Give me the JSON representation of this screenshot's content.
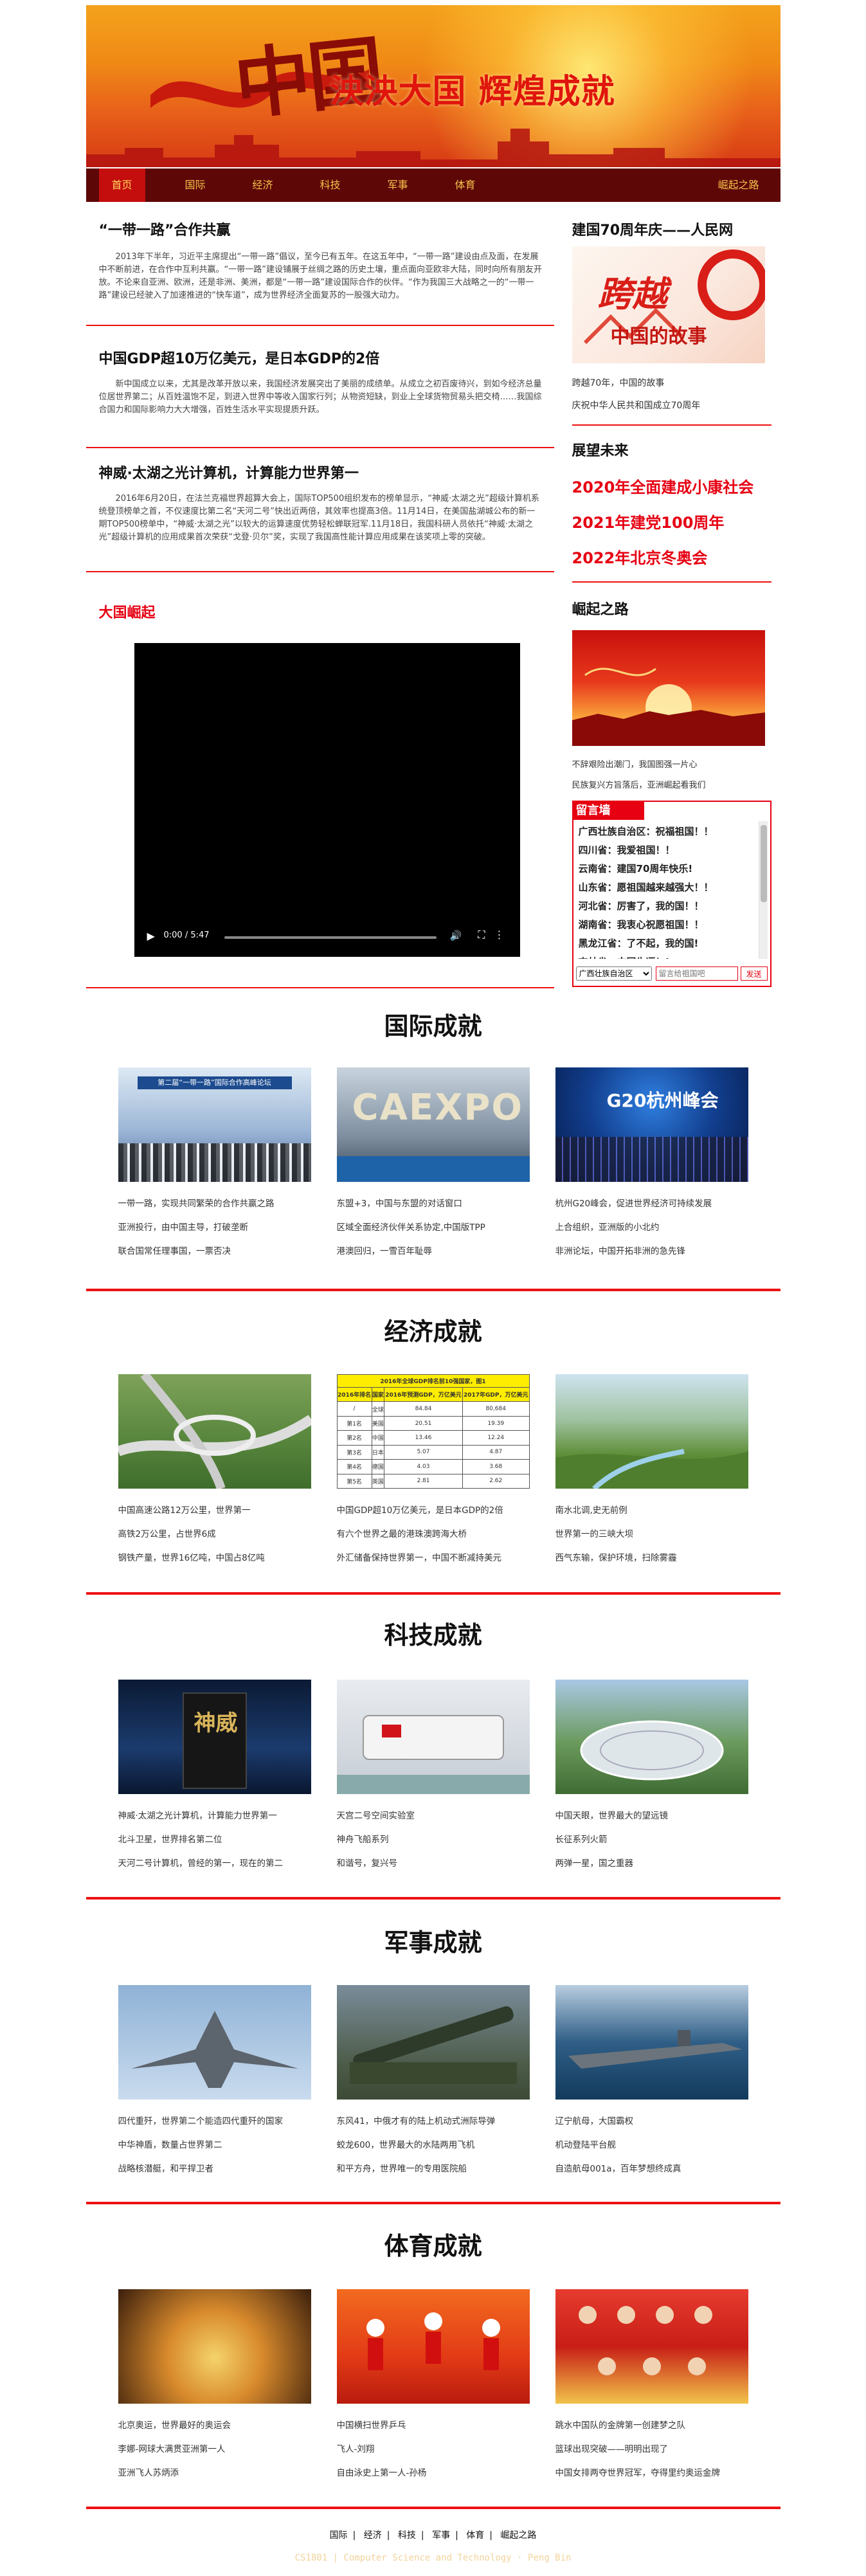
{
  "banner": {
    "calligraphy": "中国",
    "slogan": "泱泱大国 辉煌成就"
  },
  "nav": {
    "items": [
      "首页",
      "国际",
      "经济",
      "科技",
      "军事",
      "体育"
    ],
    "right": "崛起之路"
  },
  "articles": [
    {
      "title": "“一带一路”合作共赢",
      "body": "2013年下半年，习近平主席提出“一带一路”倡议，至今已有五年。在这五年中，“一带一路”建设由点及面，在发展中不断前进，在合作中互利共赢。“一带一路”建设铺展于丝绸之路的历史土壤，重点面向亚欧非大陆，同时向所有朋友开放。不论来自亚洲、欧洲，还是非洲、美洲，都是“一带一路”建设国际合作的伙伴。“作为我国三大战略之一的“一带一路”建设已经驶入了加速推进的“快车道”，成为世界经济全面复苏的一股强大动力。"
    },
    {
      "title": "中国GDP超10万亿美元，是日本GDP的2倍",
      "body": "新中国成立以来，尤其是改革开放以来，我国经济发展突出了美丽的成绩单。从成立之初百废待兴，到如今经济总量位居世界第二；从百姓温饱不足，到进入世界中等收入国家行列；从物资短缺，到业上全球货物贸易头把交椅……我国综合国力和国际影响力大大增强，百姓生活水平实现提质升跃。"
    },
    {
      "title": "神威·太湖之光计算机，计算能力世界第一",
      "body": "2016年6月20日，在法兰克福世界超算大会上，国际TOP500组织发布的榜单显示，“神威·太湖之光”超级计算机系统登顶榜单之首，不仅速度比第二名“天河二号”快出近两倍，其效率也提高3倍。11月14日，在美国盐湖城公布的新一期TOP500榜单中，“神威·太湖之光”以较大的运算速度优势轻松蝉联冠军.11月18日，我国科研人员依托“神威·太湖之光”超级计算机的应用成果首次荣获“戈登·贝尔”奖，实现了我国高性能计算应用成果在该奖项上零的突破。"
    }
  ],
  "rise": {
    "title": "大国崛起",
    "video_time": "0:00 / 5:47"
  },
  "sidebar": {
    "block1_title": "建国70周年庆——人民网",
    "block1_img_text": "跨越",
    "block1_img_sub": "中国的故事",
    "block1_captions": [
      "跨越70年，中国的故事",
      "庆祝中华人民共和国成立70周年"
    ],
    "block2_title": "展望未来",
    "future": [
      "2020年全面建成小康社会",
      "2021年建党100周年",
      "2022年北京冬奥会"
    ],
    "block3_title": "崛起之路",
    "block3_caption": [
      "不辞艰险出潮门，我国图强一片心",
      "民族复兴方旨落后，亚洲崛起看我们"
    ],
    "message_board": {
      "title": "留言墙",
      "messages": [
        "广西壮族自治区：祝福祖国！！",
        "四川省：我爱祖国！！",
        "云南省：建国70周年快乐!",
        "山东省：愿祖国越来越强大！！",
        "河北省：厉害了，我的国！！",
        "湖南省：我衷心祝愿祖国！！",
        "黑龙江省：了不起，我的国!",
        "吉林省：中国牛逼！!"
      ],
      "province_select": "广西壮族自治区",
      "input_placeholder": "留言给祖国吧",
      "send": "发送"
    }
  },
  "categories": [
    {
      "title": "国际成就",
      "captions": [
        [
          "一带一路，实现共同繁荣的合作共赢之路",
          "亚洲投行，由中国主导，打破垄断",
          "联合国常任理事国，一票否决"
        ],
        [
          "东盟+3，中国与东盟的对话窗口",
          "区域全面经济伙伴关系协定,中国版TPP",
          "港澳回归，一雪百年耻辱"
        ],
        [
          "杭州G20峰会，促进世界经济可持续发展",
          "上合组织，亚洲版的小北约",
          "非洲论坛，中国开拓非洲的急先锋"
        ]
      ],
      "img_labels": [
        "第二届“一带一路”国际合作高峰论坛",
        "CAEXPO",
        "G20杭州峰会"
      ]
    },
    {
      "title": "经济成就",
      "captions": [
        [
          "中国高速公路12万公里，世界第一",
          "高铁2万公里，占世界6成",
          "钢铁产量，世界16亿吨，中国占8亿吨"
        ],
        [
          "中国GDP超10万亿美元，是日本GDP的2倍",
          "有六个世界之最的港珠澳跨海大桥",
          "外汇储备保持世界第一，中国不断减持美元"
        ],
        [
          "南水北调,史无前例",
          "世界第一的三峡大坝",
          "西气东输，保护环境，扫除雾霾"
        ]
      ],
      "table": {
        "title": "2016年全球GDP排名前10强国家，图1",
        "headers": [
          "2016年排名",
          "国家",
          "2016年预测GDP，万亿美元",
          "2017年GDP，万亿美元"
        ],
        "rows": [
          [
            "/",
            "全球",
            "84.84",
            "80,684"
          ],
          [
            "第1名",
            "美国",
            "20.51",
            "19.39"
          ],
          [
            "第2名",
            "中国",
            "13.46",
            "12.24"
          ],
          [
            "第3名",
            "日本",
            "5.07",
            "4.87"
          ],
          [
            "第4名",
            "德国",
            "4.03",
            "3.68"
          ],
          [
            "第5名",
            "英国",
            "2.81",
            "2.62"
          ]
        ]
      }
    },
    {
      "title": "科技成就",
      "captions": [
        [
          "神威·太湖之光计算机，计算能力世界第一",
          "北斗卫星，世界排名第二位",
          "天河二号计算机，曾经的第一，现在的第二"
        ],
        [
          "天宫二号空间实验室",
          "神舟飞船系列",
          "和谐号，复兴号"
        ],
        [
          "中国天眼，世界最大的望远镜",
          "长征系列火箭",
          "两弹一星，国之重器"
        ]
      ],
      "img_labels": [
        "神威",
        "",
        ""
      ]
    },
    {
      "title": "军事成就",
      "captions": [
        [
          "四代重歼，世界第二个能造四代重歼的国家",
          "中华神盾，数量占世界第二",
          "战略核潜艇，和平捍卫者"
        ],
        [
          "东风41，中俄才有的陆上机动式洲际导弹",
          "蛟龙600，世界最大的水陆两用飞机",
          "和平方舟，世界唯一的专用医院船"
        ],
        [
          "辽宁航母，大国霸权",
          "机动登陆平台舰",
          "自造航母001a，百年梦想终成真"
        ]
      ]
    },
    {
      "title": "体育成就",
      "captions": [
        [
          "北京奥运，世界最好的奥运会",
          "李娜-网球大满贯亚洲第一人",
          "亚洲飞人苏炳添"
        ],
        [
          "中国横扫世界乒乓",
          "飞人-刘翔",
          "自由泳史上第一人-孙杨"
        ],
        [
          "跳水中国队的金牌第一创建梦之队",
          "篮球出现突破——明明出现了",
          "中国女排两夺世界冠军，夺得里约奥运金牌"
        ]
      ]
    }
  ],
  "footer": {
    "links": [
      "国际",
      "经济",
      "科技",
      "军事",
      "体育",
      "崛起之路"
    ],
    "copyright": "CS1801 | Computer Science and Technology · Peng Bin"
  },
  "colors": {
    "accent_red": "#e60012",
    "nav_bg": "#5e0707",
    "nav_text": "#f5c24a"
  }
}
